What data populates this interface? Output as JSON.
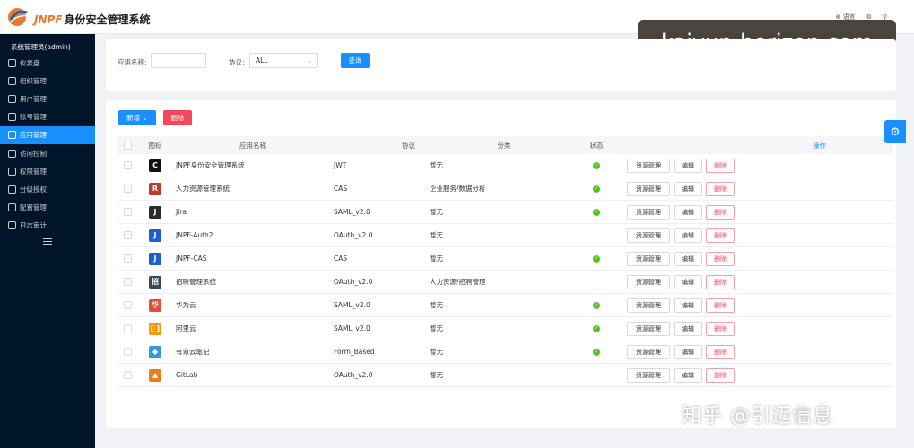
{
  "header": {
    "brand_en": "JNPF",
    "brand_cn": "身份安全管理系统",
    "lang_label": "语言",
    "watermark": "kaiyun-horizon.com"
  },
  "sidebar": {
    "user_label": "系统管理员(admin)",
    "items": [
      {
        "label": "仪表盘"
      },
      {
        "label": "组织管理"
      },
      {
        "label": "用户管理"
      },
      {
        "label": "账号管理"
      },
      {
        "label": "应用管理"
      },
      {
        "label": "访问控制"
      },
      {
        "label": "权限管理"
      },
      {
        "label": "分级授权"
      },
      {
        "label": "配置管理"
      },
      {
        "label": "日志审计"
      }
    ]
  },
  "search": {
    "app_name_label": "应用名称:",
    "app_name_value": "",
    "protocol_label": "协议:",
    "protocol_value": "ALL",
    "query_button": "查询"
  },
  "toolbar": {
    "add_button": "新增",
    "delete_button": "删除"
  },
  "table": {
    "headers": {
      "icon": "图标",
      "name": "应用名称",
      "protocol": "协议",
      "category": "分类",
      "status": "状态",
      "ops": "操作"
    },
    "op_labels": {
      "resource": "资源管理",
      "edit": "编辑",
      "delete": "删除"
    },
    "rows": [
      {
        "name": "JNPF身份安全管理系统",
        "protocol": "JWT",
        "category": "暂无",
        "status": "ok",
        "icon": "c-logo-icon",
        "icon_color": "#111111",
        "icon_glyph": "C"
      },
      {
        "name": "人力资源管理系统",
        "protocol": "CAS",
        "category": "企业服务/数据分析",
        "status": "ok",
        "icon": "r-logo-icon",
        "icon_color": "#c0392b",
        "icon_glyph": "R"
      },
      {
        "name": "Jira",
        "protocol": "SAML_v2.0",
        "category": "暂无",
        "status": "ok",
        "icon": "jira-logo-icon",
        "icon_color": "#2b2b2b",
        "icon_glyph": "J"
      },
      {
        "name": "JNPF-Auth2",
        "protocol": "OAuth_v2.0",
        "category": "暂无",
        "status": "",
        "icon": "j-logo-icon",
        "icon_color": "#1e5ec8",
        "icon_glyph": "J"
      },
      {
        "name": "JNPF-CAS",
        "protocol": "CAS",
        "category": "暂无",
        "status": "ok",
        "icon": "j-logo-icon",
        "icon_color": "#1e5ec8",
        "icon_glyph": "J"
      },
      {
        "name": "招聘管理系统",
        "protocol": "OAuth_v2.0",
        "category": "人力资源/招聘管理",
        "status": "",
        "icon": "recruit-logo-icon",
        "icon_color": "#34495e",
        "icon_glyph": "招"
      },
      {
        "name": "华为云",
        "protocol": "SAML_v2.0",
        "category": "暂无",
        "status": "ok",
        "icon": "huawei-logo-icon",
        "icon_color": "#e74c3c",
        "icon_glyph": "华"
      },
      {
        "name": "阿里云",
        "protocol": "SAML_v2.0",
        "category": "暂无",
        "status": "ok",
        "icon": "aliyun-logo-icon",
        "icon_color": "#f39c12",
        "icon_glyph": "[ ]"
      },
      {
        "name": "有道云笔记",
        "protocol": "Form_Based",
        "category": "暂无",
        "status": "ok",
        "icon": "youdao-logo-icon",
        "icon_color": "#3498db",
        "icon_glyph": "◆"
      },
      {
        "name": "GitLab",
        "protocol": "OAuth_v2.0",
        "category": "暂无",
        "status": "",
        "icon": "gitlab-logo-icon",
        "icon_color": "#e67e22",
        "icon_glyph": "▲"
      }
    ]
  },
  "overlay": {
    "zhihu": "知乎 @引迈信息"
  }
}
